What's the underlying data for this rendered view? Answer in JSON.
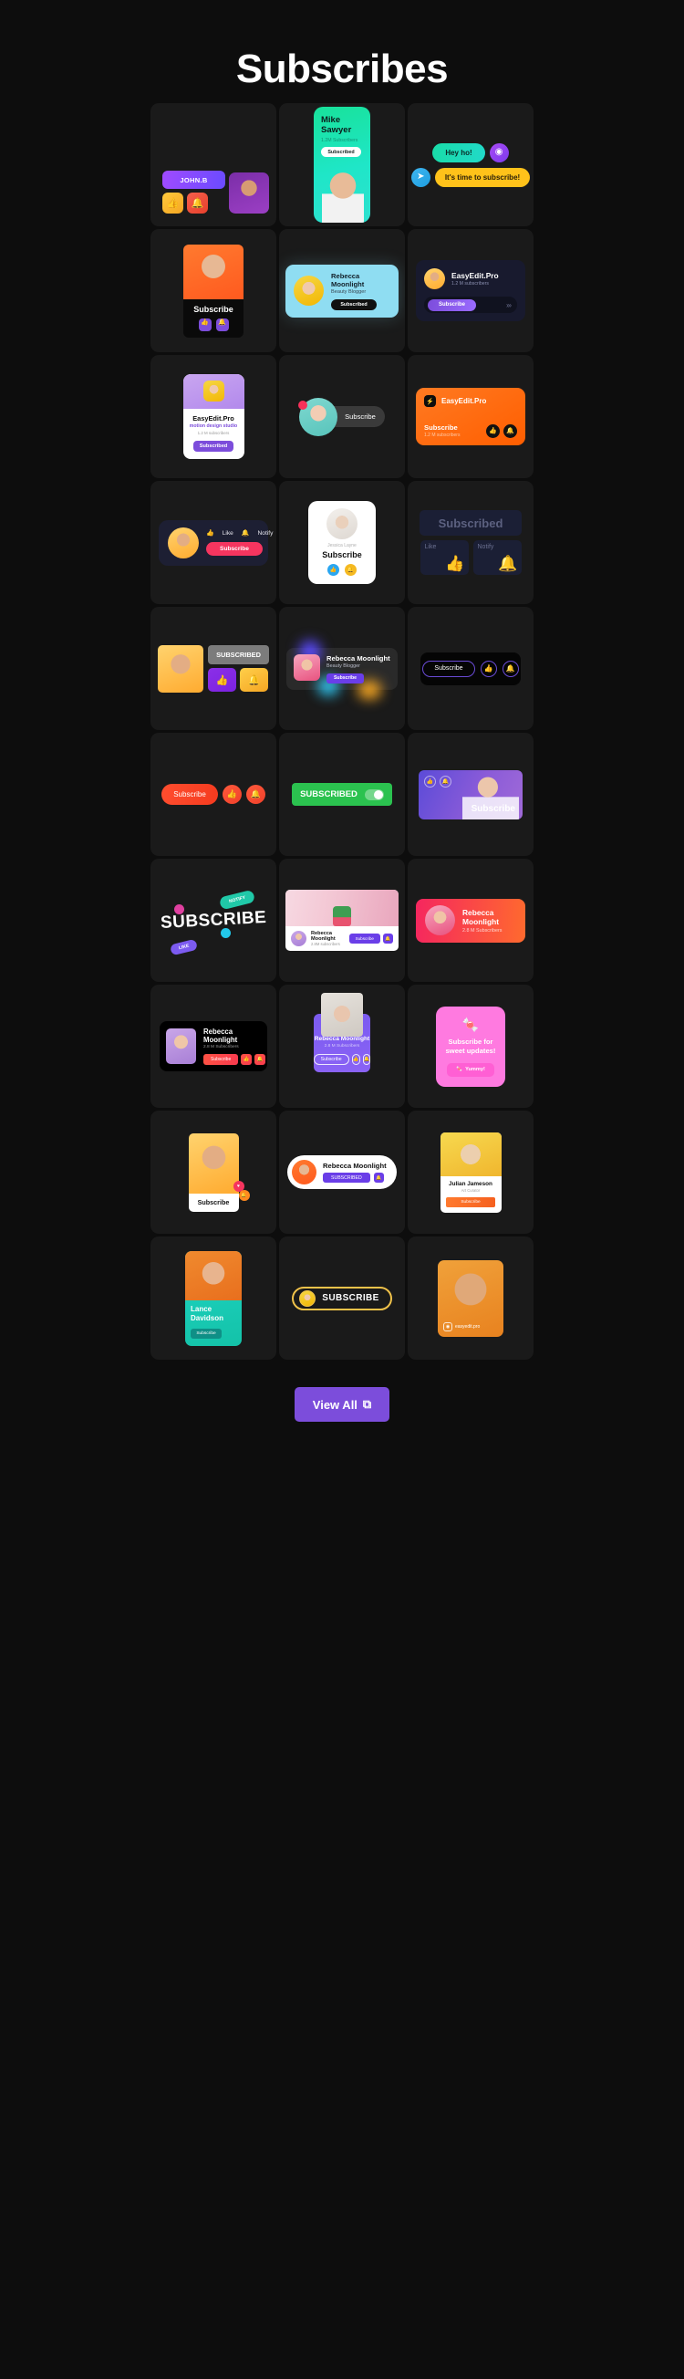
{
  "header": {
    "title": "Subscribes"
  },
  "footer": {
    "view_all_label": "View All",
    "external_icon": "external-link-icon"
  },
  "cards": {
    "c1": {
      "name": "JOHN.B",
      "like_icon": "thumbs-up-icon",
      "bell_icon": "bell-icon"
    },
    "c2": {
      "name": "Mike Sawyer",
      "subscribers": "1.2M Subscribers",
      "button": "Subscribed"
    },
    "c3": {
      "msg1": "Hey ho!",
      "msg2": "It's time to subscribe!",
      "ig_icon": "instagram-icon",
      "tg_icon": "telegram-icon"
    },
    "c4": {
      "label": "Subscribe",
      "like_icon": "thumbs-up-icon",
      "bell_icon": "bell-icon"
    },
    "c5": {
      "name": "Rebecca Moonlight",
      "role": "Beauty Blogger",
      "button": "Subscribed"
    },
    "c6": {
      "name": "EasyEdit.Pro",
      "subscribers": "1.2 M subscribers",
      "button": "Subscribe",
      "chevrons": "›››"
    },
    "c7": {
      "name": "EasyEdit.Pro",
      "tagline": "motion design studio",
      "subscribers": "1.2 M subscribers",
      "button": "Subscribed"
    },
    "c8": {
      "label": "Subscribe"
    },
    "c9": {
      "name": "EasyEdit.Pro",
      "action": "Subscribe",
      "subscribers": "1.2 M subscribers",
      "logo_icon": "bolt-icon",
      "like_icon": "thumbs-up-icon",
      "bell_icon": "bell-icon"
    },
    "c10": {
      "like": "Like",
      "notify": "Notify",
      "button": "Subscribe"
    },
    "c11": {
      "name": "Jessica Layne",
      "button": "Subscribe",
      "like_icon": "thumbs-up-icon",
      "bell_icon": "bell-icon"
    },
    "c12": {
      "status": "Subscribed",
      "like": "Like",
      "notify": "Notify"
    },
    "c13": {
      "status": "SUBSCRIBED",
      "like_icon": "thumbs-up-icon",
      "bell_icon": "bell-icon"
    },
    "c14": {
      "name": "Rebecca Moonlight",
      "role": "Beauty Blogger",
      "button": "Subscribe"
    },
    "c15": {
      "button": "Subscribe",
      "like_icon": "thumbs-up-icon",
      "bell_icon": "bell-icon"
    },
    "c16": {
      "button": "Subscribe",
      "like_icon": "thumbs-up-icon",
      "bell_icon": "bell-icon"
    },
    "c17": {
      "status": "SUBSCRIBED"
    },
    "c18": {
      "label": "Subscribe",
      "like_icon": "thumbs-up-icon",
      "bell_icon": "bell-icon"
    },
    "c19": {
      "title": "SUBSCRIBE",
      "like": "LIKE",
      "notify": "NOTIFY"
    },
    "c20": {
      "name": "Rebecca Moonlight",
      "subscribers": "2.8M subscribers",
      "button": "Subscribe",
      "bell_icon": "bell-icon"
    },
    "c21": {
      "name": "Rebecca Moonlight",
      "subscribers": "2.8 M Subscribers"
    },
    "c22": {
      "name": "Rebecca Moonlight",
      "subscribers": "2.8 M Subscribers",
      "button": "Subscribe",
      "like_icon": "thumbs-up-icon",
      "bell_icon": "bell-icon"
    },
    "c23": {
      "name": "Rebecca Moonlight",
      "subscribers": "2.8 M Subscribers",
      "button": "Subscribe",
      "like_icon": "thumbs-up-icon",
      "bell_icon": "bell-icon"
    },
    "c24": {
      "title": "Subscribe for sweet updates!",
      "button": "Yummy!",
      "candy_icon": "candy-icon"
    },
    "c25": {
      "label": "Subscribe",
      "badge1_icon": "heart-icon",
      "badge2_icon": "bell-icon"
    },
    "c26": {
      "name": "Rebecca Moonlight",
      "button": "SUBSCRIBED",
      "bell_icon": "bell-icon"
    },
    "c27": {
      "name": "Julian Jameson",
      "role": "Art Curator",
      "button": "Subscribe"
    },
    "c28": {
      "name": "Lance Davidson",
      "button": "Subscribe"
    },
    "c29": {
      "label": "SUBSCRIBE"
    },
    "c30": {
      "handle": "easyedit.pro",
      "logo_icon": "instagram-icon"
    }
  },
  "colors": {
    "background": "#0d0d0d",
    "card_surface": "#1a1a1a",
    "accent_purple": "#7c4ddb",
    "accent_green": "#2bc24f",
    "accent_orange": "#ff5e00",
    "accent_pink": "#ff7ae0",
    "accent_red": "#f5355f",
    "accent_teal": "#19dca8",
    "accent_yellow": "#ffc21a"
  }
}
